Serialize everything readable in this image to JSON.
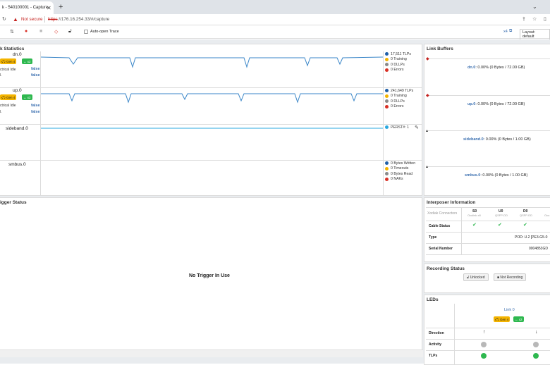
{
  "browser": {
    "tab_title": "k - 540100001 - Capture",
    "not_secure": "Not secure",
    "url_scheme": "https",
    "url_rest": "://176.16.254.33/#/capture"
  },
  "toolbar": {
    "auto_open_label": "Auto-open Trace",
    "zoom_label": "x4",
    "layout_label": "Layout: default"
  },
  "link_statistics": {
    "title": "k Statistics",
    "rows": [
      {
        "name": "dn.0",
        "gen": "Gen 4",
        "lanes": "x2",
        "idle_label": "ctrical Idle",
        "value1": "false",
        "value2": "false",
        "legend": [
          "17,511 TLPs",
          "0 Training",
          "0 DLLPs",
          "0 Errors"
        ]
      },
      {
        "name": "up.0",
        "gen": "Gen 4",
        "lanes": "x2",
        "idle_label": "ctrical Idle",
        "value1": "false",
        "value2": "false",
        "legend": [
          "241,649 TLPs",
          "0 Training",
          "0 DLLPs",
          "0 Errors"
        ]
      },
      {
        "name": "sideband.0",
        "legend": [
          "PERST#: 1"
        ]
      },
      {
        "name": "smbus.0",
        "legend": [
          "0 Bytes Written",
          "0 Timeouts",
          "0 Bytes Read",
          "0 NAKs"
        ]
      }
    ],
    "colors": {
      "blue": "#1f5fa8",
      "yellow": "#f4b400",
      "green": "#2eb84f",
      "gray": "#8a8a8a",
      "red": "#d93025",
      "cyan": "#29a8e0"
    }
  },
  "link_buffers": {
    "title": "Link Buffers",
    "rows": [
      {
        "name": "dn.0",
        "text": ": 0.00% (0 Bytes / 72.00 GB)"
      },
      {
        "name": "up.0",
        "text": ": 0.00% (0 Bytes / 72.00 GB)"
      },
      {
        "name": "sideband.0",
        "text": ": 0.00% (0 Bytes / 1.00 GB)"
      },
      {
        "name": "smbus.0",
        "text": ": 0.00% (0 Bytes / 1.00 GB)"
      }
    ]
  },
  "trigger": {
    "title": "igger Status",
    "message": "No Trigger In Use"
  },
  "interposer": {
    "title": "Interposer Information",
    "header": "Xodiak Connectors",
    "cols": [
      {
        "name": "S0",
        "sub": "Oculink x8"
      },
      {
        "name": "U0",
        "sub": "QSFP-DD"
      },
      {
        "name": "D0",
        "sub": "QSFP-DD"
      },
      {
        "name": "",
        "sub": "Ocu"
      }
    ],
    "cable_status_label": "Cable Status",
    "type_label": "Type",
    "type_value": "POD: U.2 [PE3-G5-0",
    "serial_label": "Serial Number",
    "serial_value": "0004853GD"
  },
  "recording": {
    "title": "Recording Status",
    "unlocked": "Unlocked",
    "not_recording": "Not Recording"
  },
  "leds": {
    "title": "LEDs",
    "link_label": "Link 0",
    "gen": "Gen 4",
    "lanes": "x2",
    "direction_label": "Direction",
    "activity_label": "Activity",
    "tlps_label": "TLPs",
    "up_arrow": "↑",
    "down_arrow": "↓"
  }
}
